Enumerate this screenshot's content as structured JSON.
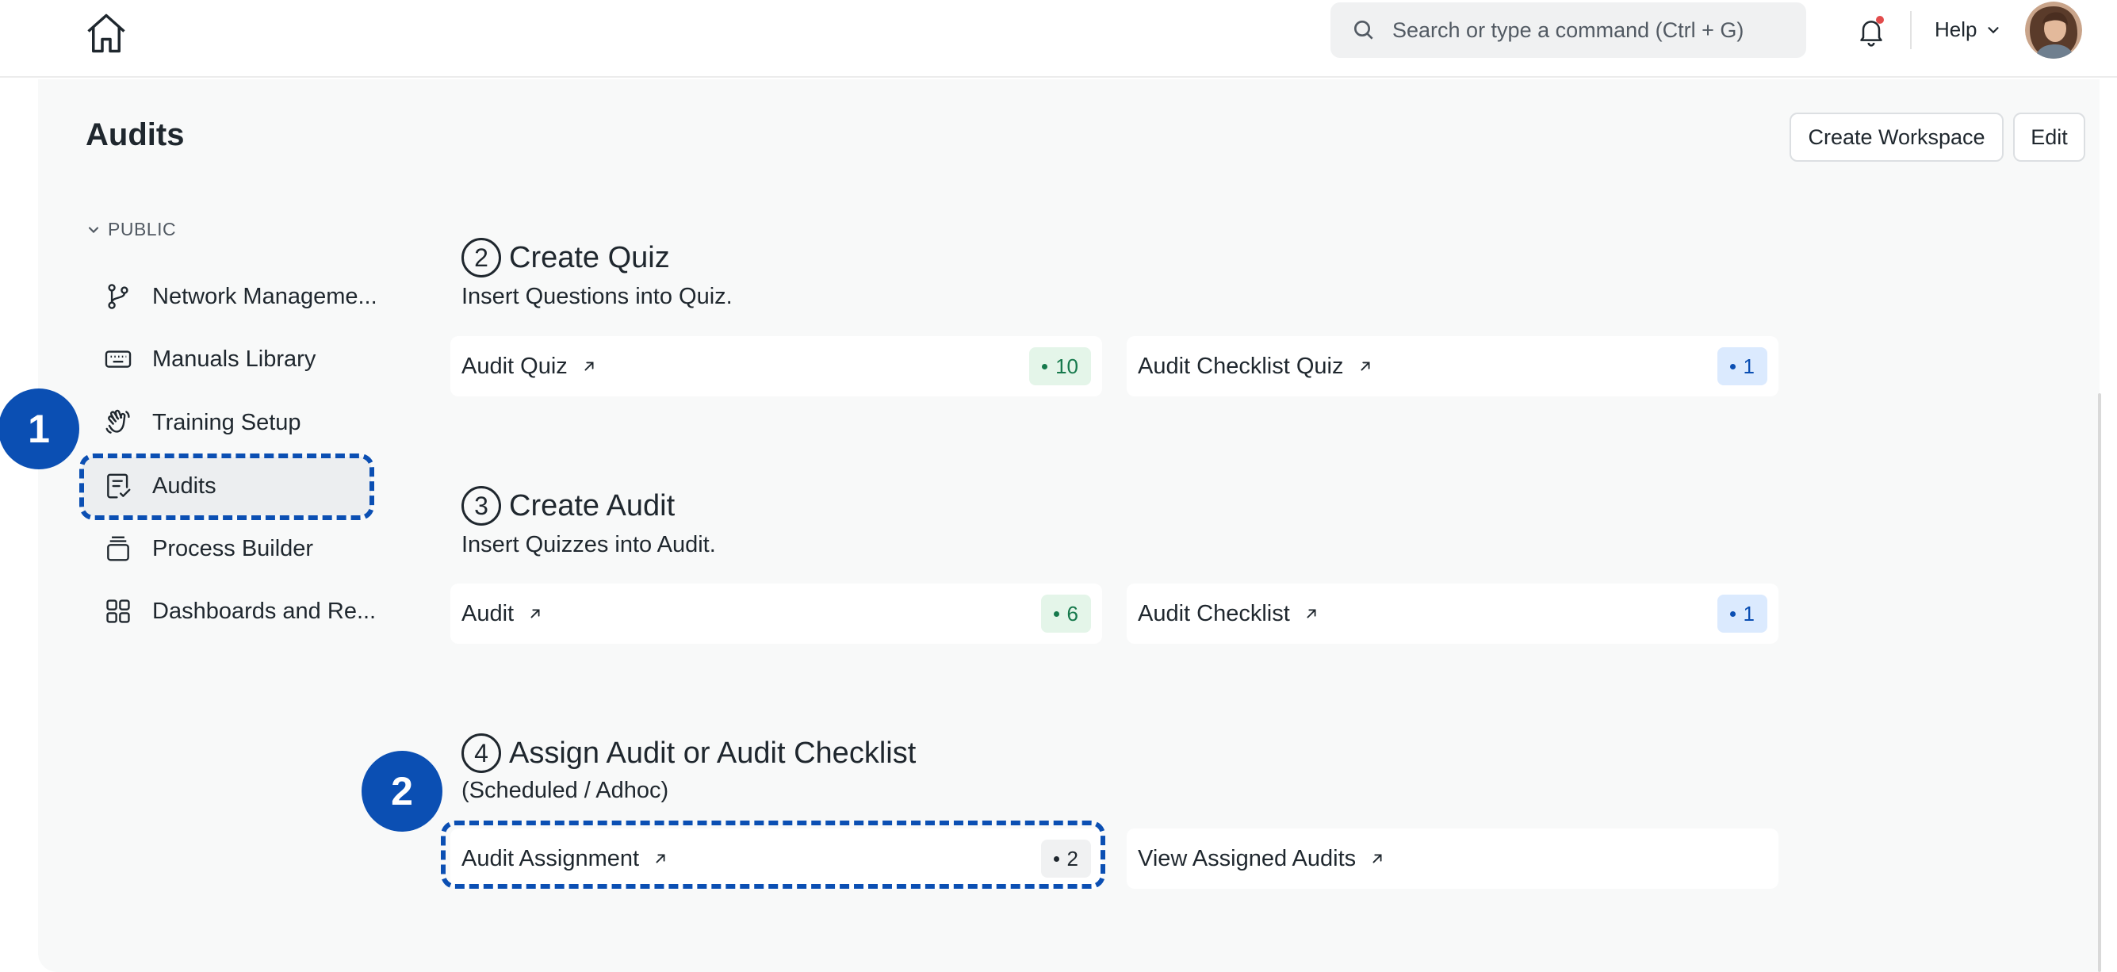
{
  "navbar": {
    "search_placeholder": "Search or type a command (Ctrl + G)",
    "help_label": "Help"
  },
  "page": {
    "title": "Audits",
    "create_workspace_label": "Create Workspace",
    "edit_label": "Edit"
  },
  "sidebar": {
    "section_label": "PUBLIC",
    "items": [
      {
        "label": "Network Manageme...",
        "icon": "git-branch-icon"
      },
      {
        "label": "Manuals Library",
        "icon": "keyboard-icon"
      },
      {
        "label": "Training Setup",
        "icon": "hand-wave-icon"
      },
      {
        "label": "Audits",
        "icon": "checklist-icon",
        "active": true
      },
      {
        "label": "Process Builder",
        "icon": "layers-icon"
      },
      {
        "label": "Dashboards and Re...",
        "icon": "grid-icon"
      }
    ]
  },
  "markers": {
    "step1": "1",
    "step2": "2"
  },
  "sections": [
    {
      "number": "2",
      "title": "Create Quiz",
      "subtitle": "Insert Questions into Quiz.",
      "cards": [
        {
          "label": "Audit Quiz",
          "count": "10",
          "badge_color": "green"
        },
        {
          "label": "Audit Checklist Quiz",
          "count": "1",
          "badge_color": "blue"
        }
      ]
    },
    {
      "number": "3",
      "title": "Create Audit",
      "subtitle": "Insert Quizzes into Audit.",
      "cards": [
        {
          "label": "Audit",
          "count": "6",
          "badge_color": "green"
        },
        {
          "label": "Audit Checklist",
          "count": "1",
          "badge_color": "blue"
        }
      ]
    },
    {
      "number": "4",
      "title": "Assign Audit or Audit Checklist",
      "subtitle": "(Scheduled / Adhoc)",
      "cards": [
        {
          "label": "Audit Assignment",
          "count": "2",
          "badge_color": "gray"
        },
        {
          "label": "View Assigned Audits"
        }
      ]
    }
  ],
  "colors": {
    "accent": "#0b4fb3",
    "badge_green_bg": "#e4f5e9",
    "badge_blue_bg": "#dbeafe",
    "page_bg": "#f8f9f9"
  }
}
